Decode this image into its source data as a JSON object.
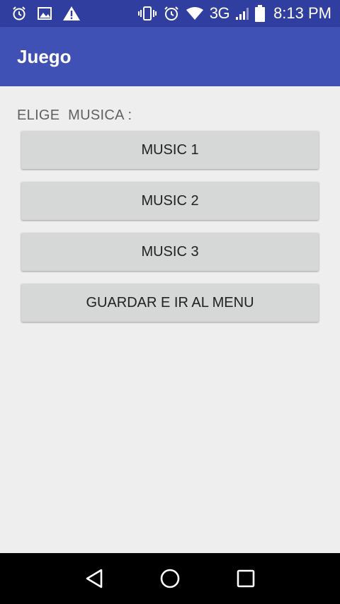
{
  "status_bar": {
    "left_icons": [
      "alarm-icon",
      "image-icon",
      "warning-icon"
    ],
    "network": "3G",
    "time": "8:13 PM"
  },
  "app_bar": {
    "title": "Juego"
  },
  "main": {
    "label": "ELIGE  MUSICA :",
    "buttons": [
      {
        "label": "MUSIC 1"
      },
      {
        "label": "MUSIC 2"
      },
      {
        "label": "MUSIC 3"
      },
      {
        "label": "GUARDAR E IR AL MENU"
      }
    ]
  },
  "nav_bar": {
    "icons": [
      "back-icon",
      "home-icon",
      "recents-icon"
    ]
  },
  "colors": {
    "status_bar": "#303f9f",
    "app_bar": "#3f51b5",
    "background": "#eeeeee",
    "button": "#d6d7d7"
  }
}
